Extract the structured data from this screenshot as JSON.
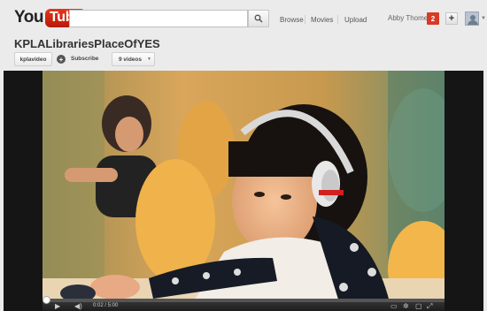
{
  "header": {
    "logo_you": "You",
    "logo_tube": "Tube",
    "search_placeholder": "",
    "nav": [
      "Browse",
      "Movies",
      "Upload"
    ],
    "user_name": "Abby Thome",
    "notification_count": "2",
    "plus_label": "+"
  },
  "channel": {
    "title": "KPLALibrariesPlaceOfYES",
    "username_button": "kplavideo",
    "subscribe_label": "Subscribe",
    "videos_button": "9 videos"
  },
  "player": {
    "time_display": "0:02 / 5:00",
    "progress_fraction": 0.007
  },
  "colors": {
    "logo_red": "#cc181e",
    "notification_red": "#d93a25",
    "player_bg": "#151515"
  }
}
